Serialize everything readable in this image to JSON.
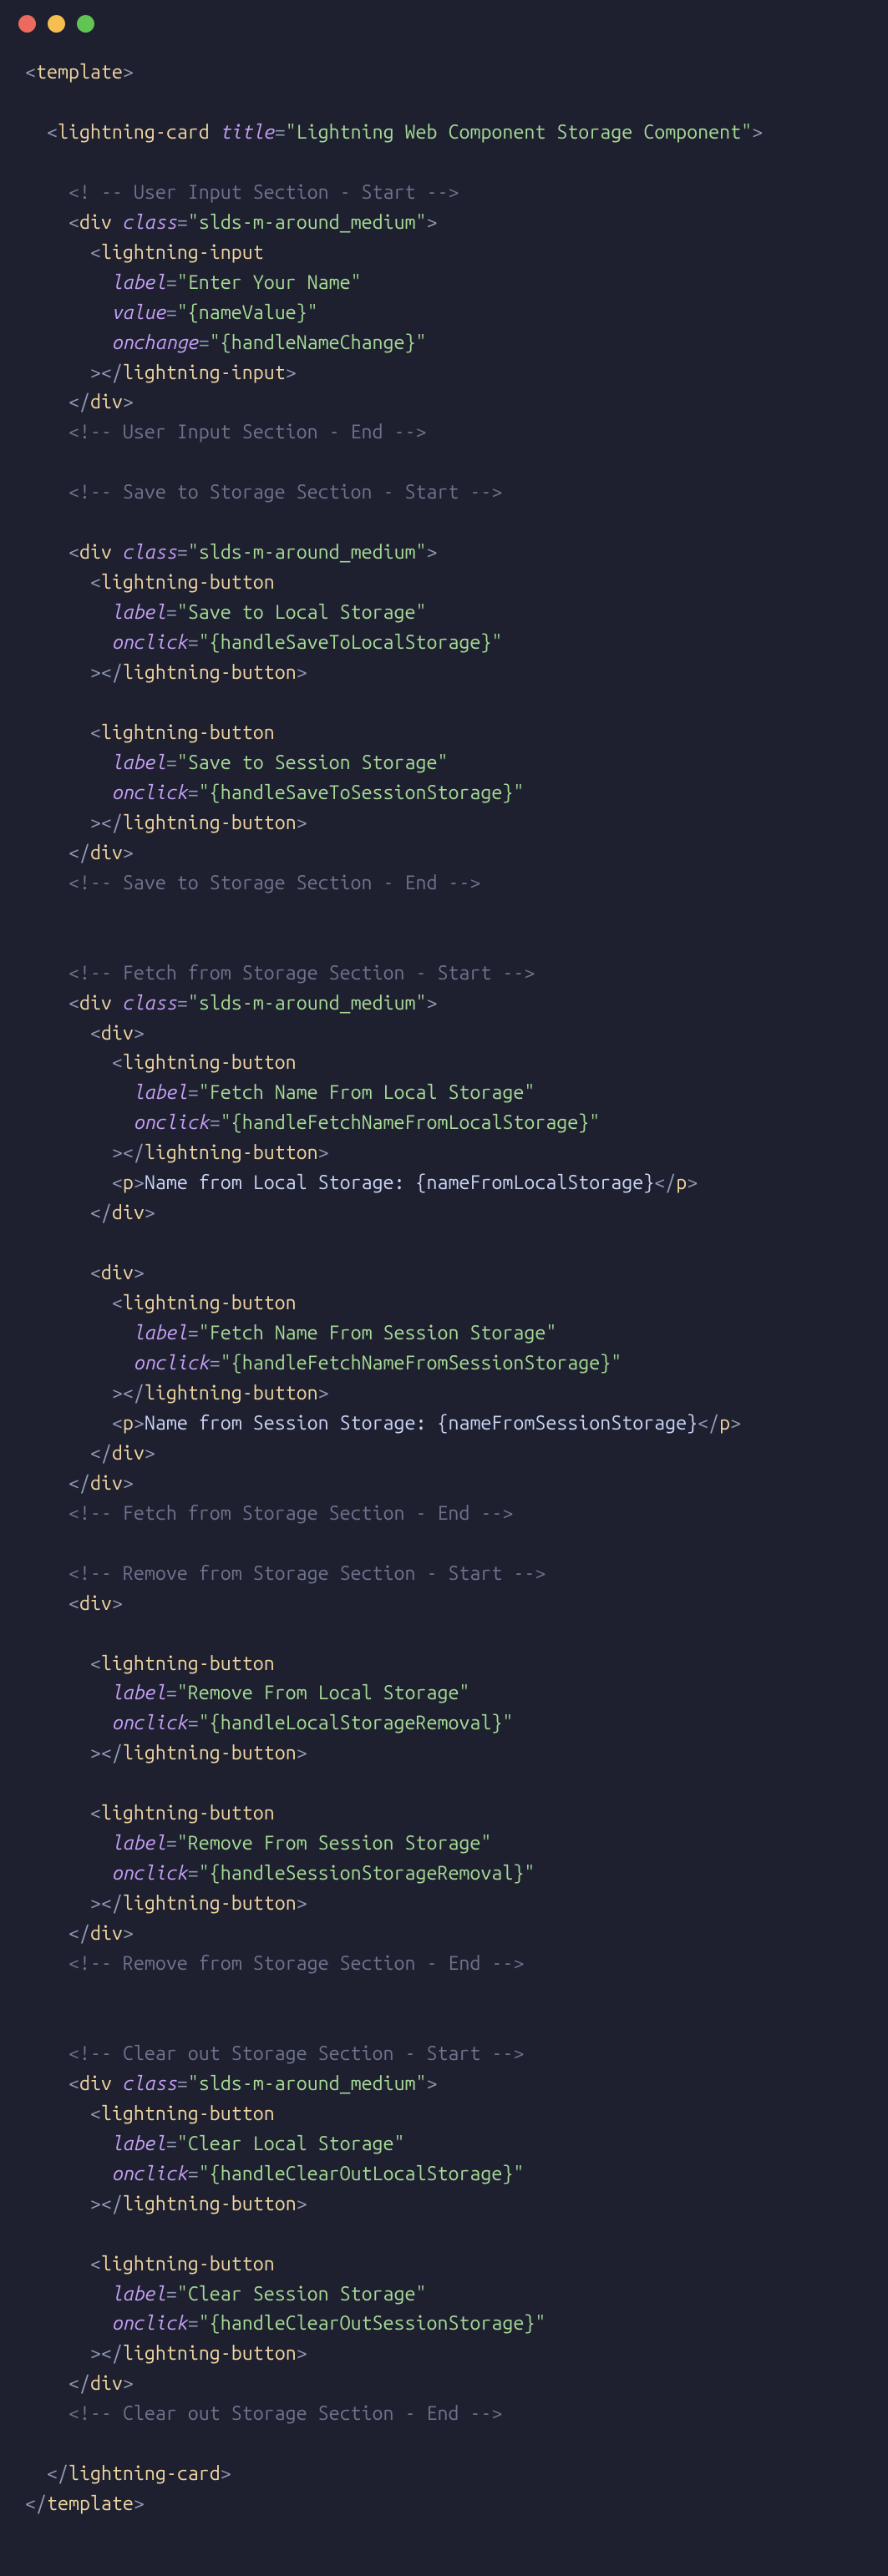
{
  "titlebar": {
    "dots": [
      "red",
      "yellow",
      "green"
    ]
  },
  "t": {
    "template": "template",
    "lightning_card": "lightning-card",
    "lightning_input": "lightning-input",
    "lightning_button": "lightning-button",
    "div": "div",
    "p": "p"
  },
  "a": {
    "title": "title",
    "class": "class",
    "label": "label",
    "value": "value",
    "onchange": "onchange",
    "onclick": "onclick"
  },
  "s": {
    "card_title": "\"Lightning Web Component Storage Component\"",
    "slds": "\"slds-m-around_medium\"",
    "enter_name": "\"Enter Your Name\"",
    "name_value": "\"{nameValue}\"",
    "handle_name_change": "\"{handleNameChange}\"",
    "save_local": "\"Save to Local Storage\"",
    "h_save_local": "\"{handleSaveToLocalStorage}\"",
    "save_session": "\"Save to Session Storage\"",
    "h_save_session": "\"{handleSaveToSessionStorage}\"",
    "fetch_local": "\"Fetch Name From Local Storage\"",
    "h_fetch_local": "\"{handleFetchNameFromLocalStorage}\"",
    "fetch_session": "\"Fetch Name From Session Storage\"",
    "h_fetch_session": "\"{handleFetchNameFromSessionStorage}\"",
    "remove_local": "\"Remove From Local Storage\"",
    "h_remove_local": "\"{handleLocalStorageRemoval}\"",
    "remove_session": "\"Remove From Session Storage\"",
    "h_remove_session": "\"{handleSessionStorageRemoval}\"",
    "clear_local": "\"Clear Local Storage\"",
    "h_clear_local": "\"{handleClearOutLocalStorage}\"",
    "clear_session": "\"Clear Session Storage\"",
    "h_clear_session": "\"{handleClearOutSessionStorage}\""
  },
  "txt": {
    "p_local": "Name from Local Storage: {nameFromLocalStorage}",
    "p_session": "Name from Session Storage: {nameFromSessionStorage}"
  },
  "c": {
    "user_start": "<! -- User Input Section - Start -->",
    "user_end": "<!-- User Input Section - End -->",
    "save_start": "<!-- Save to Storage Section - Start -->",
    "save_end": "<!-- Save to Storage Section - End -->",
    "fetch_start": "<!-- Fetch from Storage Section - Start -->",
    "fetch_end": "<!-- Fetch from Storage Section - End -->",
    "remove_start": "<!-- Remove from Storage Section - Start -->",
    "remove_end": "<!-- Remove from Storage Section - End -->",
    "clear_start": "<!-- Clear out Storage Section - Start -->",
    "clear_end": "<!-- Clear out Storage Section - End -->"
  },
  "p": {
    "lt": "<",
    "gt": ">",
    "sl": "/",
    "eq": "="
  }
}
